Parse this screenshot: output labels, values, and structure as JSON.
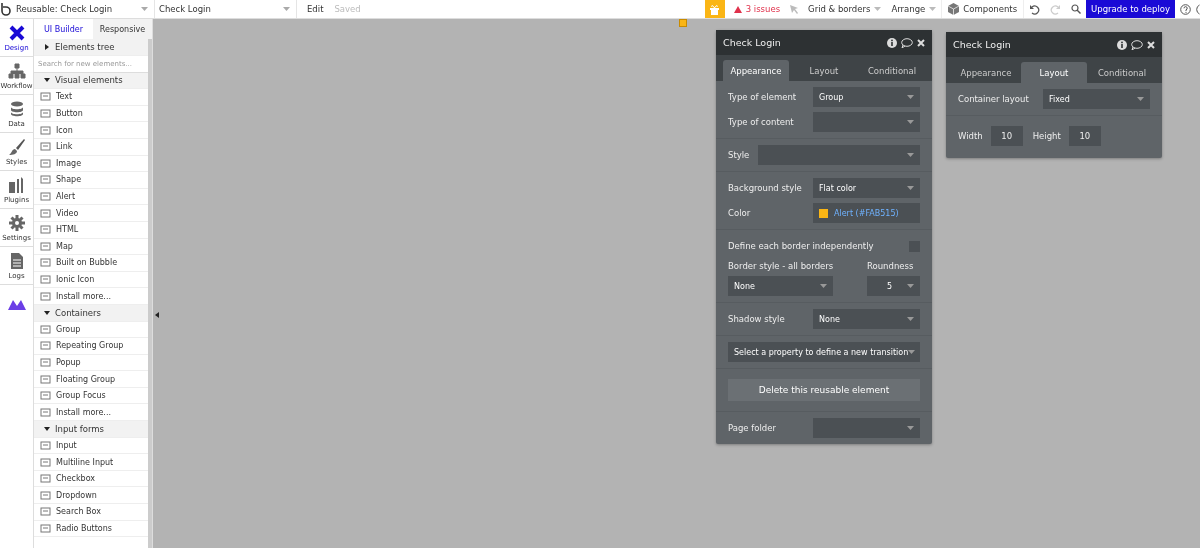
{
  "topbar": {
    "page_selector": "Reusable: Check Login",
    "element_selector": "Check Login",
    "mode": "Edit",
    "save_status": "Saved",
    "issues": "3 issues",
    "menus": [
      {
        "label": "Grid & borders"
      },
      {
        "label": "Arrange"
      }
    ],
    "components": "Components",
    "upgrade": "Upgrade to deploy"
  },
  "rail": [
    {
      "label": "Design",
      "selected": true
    },
    {
      "label": "Workflow",
      "selected": false
    },
    {
      "label": "Data",
      "selected": false
    },
    {
      "label": "Styles",
      "selected": false
    },
    {
      "label": "Plugins",
      "selected": false
    },
    {
      "label": "Settings",
      "selected": false
    },
    {
      "label": "Logs",
      "selected": false
    }
  ],
  "elements_panel": {
    "tabs": [
      {
        "label": "UI Builder",
        "selected": true
      },
      {
        "label": "Responsive",
        "selected": false
      }
    ],
    "tree": {
      "label": "Elements tree",
      "expanded": false
    },
    "search": {
      "placeholder": "Search for new elements..."
    },
    "sections": [
      {
        "title": "Visual elements",
        "expanded": true,
        "items": [
          "Text",
          "Button",
          "Icon",
          "Link",
          "Image",
          "Shape",
          "Alert",
          "Video",
          "HTML",
          "Map",
          "Built on Bubble",
          "Ionic Icon",
          "Install more..."
        ]
      },
      {
        "title": "Containers",
        "expanded": true,
        "items": [
          "Group",
          "Repeating Group",
          "Popup",
          "Floating Group",
          "Group Focus",
          "Install more..."
        ]
      },
      {
        "title": "Input forms",
        "expanded": true,
        "items": [
          "Input",
          "Multiline Input",
          "Checkbox",
          "Dropdown",
          "Search Box",
          "Radio Buttons"
        ]
      }
    ]
  },
  "property_panels": [
    {
      "title": "Check Login",
      "tabs": [
        {
          "label": "Appearance",
          "selected": true
        },
        {
          "label": "Layout",
          "selected": false
        },
        {
          "label": "Conditional",
          "selected": false
        }
      ],
      "sections": [
        [
          {
            "kind": "dropdown",
            "label": "Type of element",
            "value": "Group"
          },
          {
            "kind": "dropdown",
            "label": "Type of content"
          }
        ],
        [
          {
            "kind": "wide",
            "label": "Style"
          }
        ],
        [
          {
            "kind": "dropdown",
            "label": "Background style",
            "value": "Flat color"
          },
          {
            "kind": "color",
            "label": "Color",
            "value": "Alert (#FAB515)",
            "color": "#fab515"
          }
        ],
        [
          {
            "kind": "checkbox",
            "label": "Define each border independently",
            "checked": false
          },
          {
            "kind": "pair",
            "items": [
              {
                "label": "Border style - all borders",
                "value": "None"
              },
              {
                "label": "Roundness",
                "value": "5"
              }
            ]
          }
        ],
        [
          {
            "kind": "dropdown",
            "label": "Shadow style",
            "value": "None"
          }
        ],
        [
          {
            "kind": "select",
            "value": "Select a property to define a new transition"
          }
        ],
        [
          {
            "kind": "button",
            "label": "Delete this reusable element"
          }
        ],
        [
          {
            "kind": "dropdown",
            "label": "Page folder"
          }
        ]
      ]
    },
    {
      "title": "Check Login",
      "tabs": [
        {
          "label": "Appearance",
          "selected": false
        },
        {
          "label": "Layout",
          "selected": true
        },
        {
          "label": "Conditional",
          "selected": false
        }
      ],
      "sections": [
        [
          {
            "kind": "dropdown",
            "label": "Container layout",
            "value": "Fixed"
          }
        ],
        [
          {
            "kind": "size",
            "items": [
              {
                "label": "Width",
                "value": "10"
              },
              {
                "label": "Height",
                "value": "10"
              }
            ]
          }
        ]
      ]
    }
  ]
}
